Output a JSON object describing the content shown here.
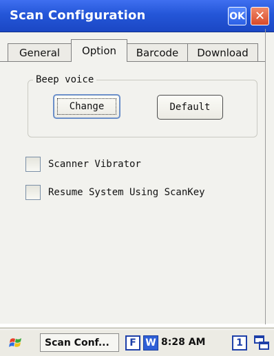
{
  "window": {
    "title": "Scan Configuration",
    "ok_label": "OK",
    "close_label": "✕"
  },
  "tabs": [
    {
      "label": "General",
      "active": false
    },
    {
      "label": "Option",
      "active": true
    },
    {
      "label": "Barcode",
      "active": false
    },
    {
      "label": "Download",
      "active": false
    }
  ],
  "beep_group": {
    "label": "Beep voice",
    "change_label": "Change",
    "default_label": "Default"
  },
  "options": {
    "vibrator": {
      "label": "Scanner Vibrator",
      "checked": false
    },
    "resume": {
      "label": "Resume System Using ScanKey",
      "checked": false
    }
  },
  "taskbar": {
    "start_icon": "windows-flag-icon",
    "task_label": "Scan Conf...",
    "tray_f": "F",
    "tray_w": "W",
    "clock": "8:28 AM",
    "tray_1": "1",
    "windows_icon": "overlapping-windows-icon"
  },
  "colors": {
    "titlebar": "#2456d8",
    "background": "#f2f2ee",
    "close": "#d84a2a"
  }
}
